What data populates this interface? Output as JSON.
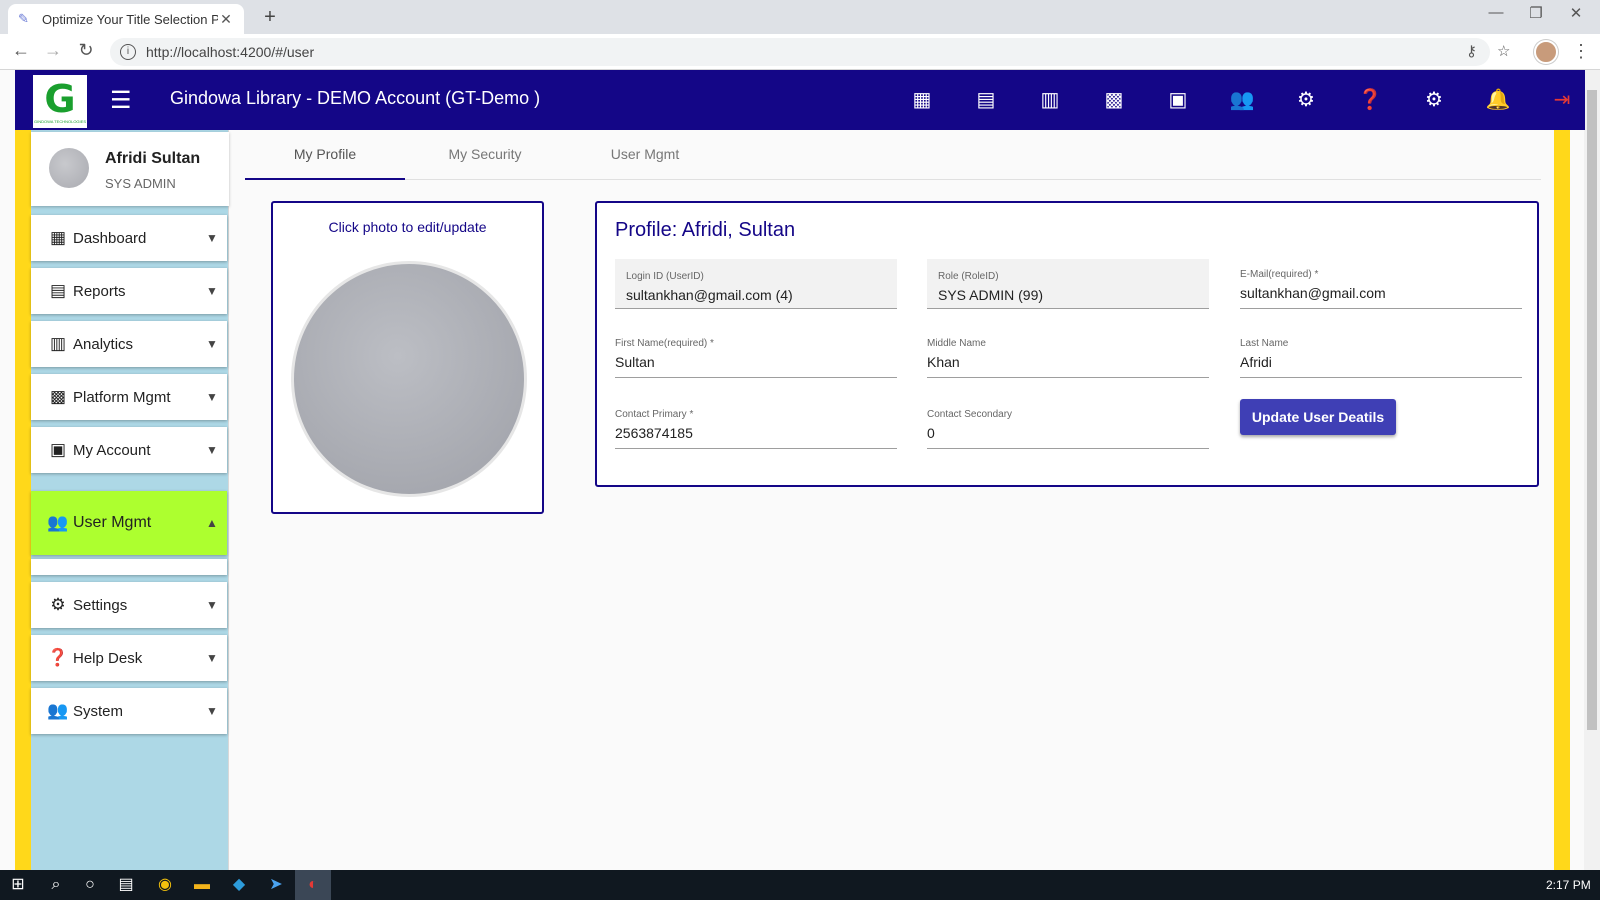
{
  "browser": {
    "tab_title": "Optimize Your Title Selection Pro",
    "url": "http://localhost:4200/#/user"
  },
  "app": {
    "title": "Gindowa Library - DEMO Account (GT-Demo )",
    "logo_letter": "G",
    "logo_caption": "GINDOWA TECHNOLOGIES",
    "toolbar_icons": [
      "dashboard-icon",
      "reports-icon",
      "analytics-icon",
      "platform-icon",
      "account-icon",
      "users-icon",
      "settings-icon",
      "help-icon",
      "system-icon",
      "notifications-icon",
      "logout-icon"
    ],
    "brand_color": "#140687",
    "accent_yellow": "#ffd81a"
  },
  "user": {
    "name": "Afridi Sultan",
    "role": "SYS ADMIN"
  },
  "sidebar": {
    "items": [
      {
        "label": "Dashboard",
        "icon": "dashboard-icon"
      },
      {
        "label": "Reports",
        "icon": "reports-icon"
      },
      {
        "label": "Analytics",
        "icon": "analytics-icon"
      },
      {
        "label": "Platform Mgmt",
        "icon": "building-icon"
      },
      {
        "label": "My Account",
        "icon": "wallet-icon"
      },
      {
        "label": "User Mgmt",
        "icon": "users-icon",
        "active": true
      },
      {
        "label": "Settings",
        "icon": "gear-icon"
      },
      {
        "label": "Help Desk",
        "icon": "help-icon"
      },
      {
        "label": "System",
        "icon": "system-icon"
      }
    ],
    "active_color": "#adff2f"
  },
  "tabs": [
    "My Profile",
    "My Security",
    "User Mgmt"
  ],
  "photo": {
    "hint": "Click photo to edit/update"
  },
  "profile": {
    "title": "Profile: Afridi, Sultan",
    "login_label": "Login ID (UserID)",
    "login_value": "sultankhan@gmail.com (4)",
    "role_label": "Role (RoleID)",
    "role_value": "SYS ADMIN (99)",
    "email_label": "E-Mail(required) *",
    "email_value": "sultankhan@gmail.com",
    "first_label": "First Name(required) *",
    "first_value": "Sultan",
    "middle_label": "Middle Name",
    "middle_value": "Khan",
    "last_label": "Last Name",
    "last_value": "Afridi",
    "contact1_label": "Contact Primary *",
    "contact1_value": "2563874185",
    "contact2_label": "Contact Secondary",
    "contact2_value": "0",
    "update_button": "Update User Deatils"
  },
  "taskbar": {
    "clock": "2:17 PM"
  }
}
